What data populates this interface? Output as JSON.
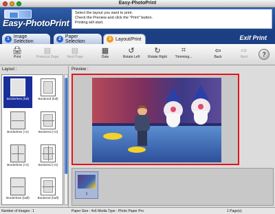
{
  "window": {
    "title": "Easy-PhotoPrint"
  },
  "header": {
    "logo_text": "Easy-PhotoPrint",
    "instructions": [
      "Select the layout you want to print.",
      "Check the Preview and click the \"Print\" button.",
      "Printing will start."
    ]
  },
  "tabs": [
    {
      "number": "1",
      "label": "Image Selection"
    },
    {
      "number": "2",
      "label": "Paper Selection"
    },
    {
      "number": "3",
      "label": "Layout/Print"
    }
  ],
  "brand": "Exif Print",
  "toolbar": {
    "print": "Print",
    "previous_page": "Previous Page",
    "next_page": "Next Page",
    "date": "Date",
    "rotate_left": "Rotate Left",
    "rotate_right": "Rotate Right",
    "trimming": "Trimming...",
    "back": "Back",
    "next": "Next",
    "help": "?"
  },
  "layout_panel": {
    "label": "Layout :",
    "items": [
      {
        "label": "Borderless (full)",
        "selected": true
      },
      {
        "label": "Bordered (full)",
        "selected": false
      },
      {
        "label": "Borderless (×2)",
        "selected": false
      },
      {
        "label": "Bordered (×2)",
        "selected": false
      },
      {
        "label": "Borderless (×4)",
        "selected": false
      },
      {
        "label": "Bordered (×4)",
        "selected": false
      },
      {
        "label": "Borderless (half)",
        "selected": false
      },
      {
        "label": "Bordered (half)",
        "selected": false
      }
    ]
  },
  "preview": {
    "label": "Preview :"
  },
  "film_strip": {
    "items": [
      {
        "caption": "1"
      }
    ]
  },
  "status": {
    "images": "Number of Images : 1",
    "paper": "Paper Size : 4x6  Media Type : Photo Paper Pro",
    "pages": "1 Page(s)"
  },
  "colors": {
    "header_blue": "#1b3f82",
    "selection_blue": "#1a2e9a",
    "preview_border": "#e0141e",
    "active_tab_badge": "#f29a1d"
  }
}
